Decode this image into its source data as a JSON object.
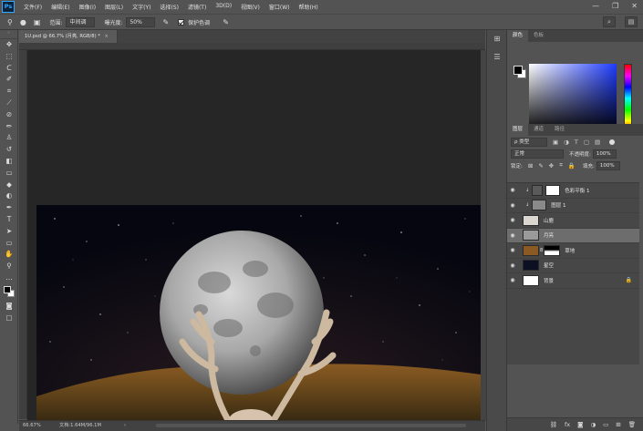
{
  "app": {
    "logo": "Ps"
  },
  "menu": [
    "文件(F)",
    "编辑(E)",
    "图像(I)",
    "图层(L)",
    "文字(Y)",
    "选择(S)",
    "滤镜(T)",
    "3D(D)",
    "视图(V)",
    "窗口(W)",
    "帮助(H)"
  ],
  "window_controls": [
    "—",
    "❐",
    "✕"
  ],
  "options": {
    "range_label": "范围:",
    "range_value": "中间调",
    "exposure_label": "曝光度:",
    "exposure_value": "50%",
    "protect_tones_label": "保护色调",
    "protect_tones_checked": true
  },
  "document": {
    "tab_title": "1U.psd @ 66.7% (月亮, RGB/8) *",
    "tab_close": "×",
    "zoom": "66.67%",
    "doc_info": "文档:1.64M/96.1M",
    "status_arrow": "›"
  },
  "color_panel": {
    "tabs": [
      "颜色",
      "色板"
    ],
    "foreground": "#000000",
    "background": "#ffffff"
  },
  "layers_panel": {
    "tabs": [
      "图层",
      "通道",
      "路径"
    ],
    "filter_kind": "ρ 类型",
    "blend_mode": "正常",
    "opacity_label": "不透明度:",
    "opacity_value": "100%",
    "lock_label": "锁定:",
    "fill_label": "填充:",
    "fill_value": "100%",
    "layers": [
      {
        "name": "色彩平衡 1",
        "visible": true,
        "selected": false,
        "thumb": "adjustment",
        "has_mask": true,
        "clipped": true
      },
      {
        "name": "图层 1",
        "visible": true,
        "selected": false,
        "thumb": "texture",
        "has_mask": false,
        "clipped": true
      },
      {
        "name": "山鹿",
        "visible": true,
        "selected": false,
        "thumb": "deer",
        "has_mask": false,
        "clipped": false
      },
      {
        "name": "月亮",
        "visible": true,
        "selected": true,
        "thumb": "moon",
        "has_mask": false,
        "clipped": false
      },
      {
        "name": "草地",
        "visible": true,
        "selected": false,
        "thumb": "grass",
        "has_mask": true,
        "clipped": false
      },
      {
        "name": "星空",
        "visible": true,
        "selected": false,
        "thumb": "sky",
        "has_mask": false,
        "clipped": false
      },
      {
        "name": "背景",
        "visible": true,
        "selected": false,
        "thumb": "white",
        "has_mask": false,
        "clipped": false,
        "locked": true
      }
    ]
  },
  "tools": [
    "move-icon",
    "marquee-icon",
    "lasso-icon",
    "quick-select-icon",
    "crop-icon",
    "eyedropper-icon",
    "healing-icon",
    "brush-icon",
    "stamp-icon",
    "history-brush-icon",
    "eraser-icon",
    "gradient-icon",
    "blur-icon",
    "dodge-icon",
    "pen-icon",
    "type-icon",
    "path-select-icon",
    "rectangle-icon",
    "hand-icon",
    "zoom-icon"
  ]
}
